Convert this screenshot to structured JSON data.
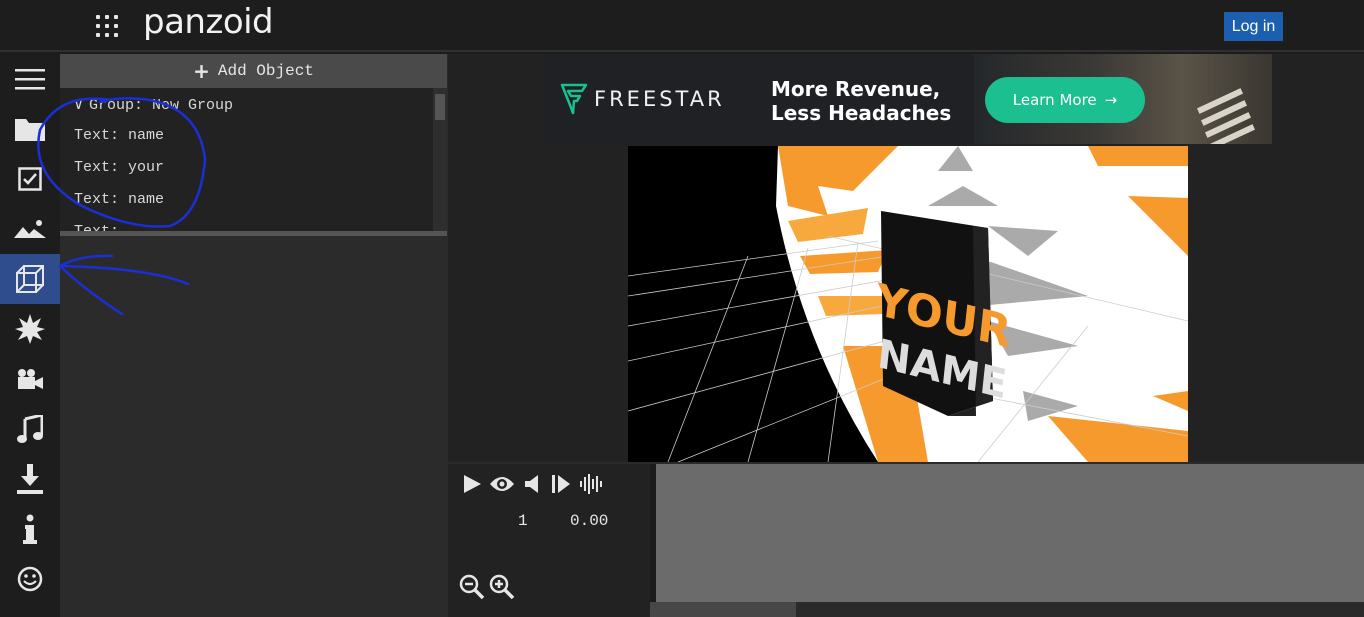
{
  "header": {
    "brand": "panzoid",
    "login_label": "Log in"
  },
  "sidebar": {
    "items": [
      {
        "icon": "menu-icon",
        "active": false
      },
      {
        "icon": "folder-icon",
        "active": false
      },
      {
        "icon": "checkbox-icon",
        "active": false
      },
      {
        "icon": "image-icon",
        "active": false
      },
      {
        "icon": "cube-icon",
        "active": true
      },
      {
        "icon": "burst-icon",
        "active": false
      },
      {
        "icon": "camera-icon",
        "active": false
      },
      {
        "icon": "music-icon",
        "active": false
      },
      {
        "icon": "download-icon",
        "active": false
      },
      {
        "icon": "info-icon",
        "active": false
      },
      {
        "icon": "smiley-icon",
        "active": false
      }
    ]
  },
  "objects": {
    "add_label": "Add Object",
    "group_label": "Group: New Group",
    "items": [
      "Text: name",
      "Text: your",
      "Text: name",
      "Text: ..."
    ]
  },
  "ad": {
    "brand": "FREESTAR",
    "headline_1": "More Revenue,",
    "headline_2": "Less Headaches",
    "cta": "Learn More"
  },
  "preview": {
    "text_3d": "YOUR NAME"
  },
  "transport": {
    "frame": "1",
    "seconds": "0.00"
  },
  "colors": {
    "accent": "#1c5fae",
    "active_rail": "#2f4d8c",
    "ad_cta": "#1cbf8f",
    "orange": "#f79a2e",
    "annotation": "#1a2fd6"
  }
}
